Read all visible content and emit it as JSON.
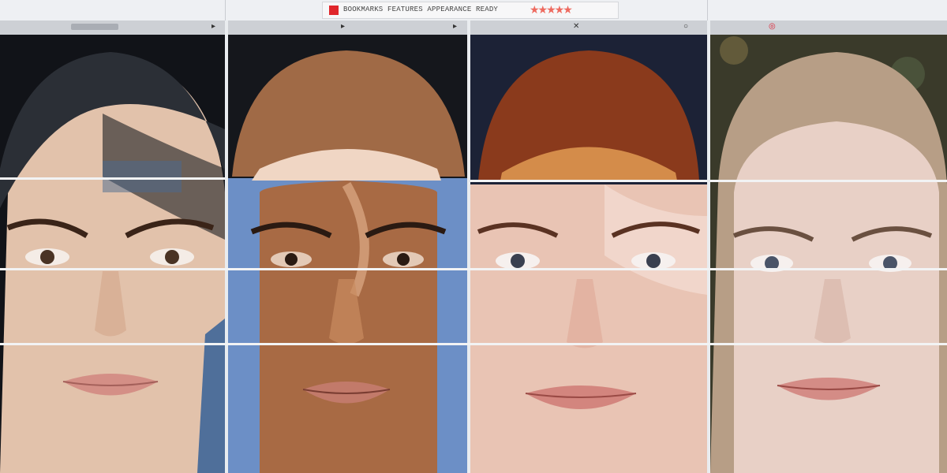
{
  "window": {
    "title_text": "BOOKMARKS  FEATURES  APPEARANCE  READY",
    "stars_text": "★★★★★",
    "toolbar_glyphs": [
      "▸",
      "▸",
      "▸",
      "✕",
      "○",
      "◎"
    ]
  },
  "panels": [
    {
      "name": "face-1",
      "hair": "#2b2f36",
      "skin": "#e4c4ae",
      "bg": "#111318"
    },
    {
      "name": "face-2",
      "hair": "#a06a46",
      "skin": "#a86a44",
      "bg": "#15171c",
      "scarf": "#6c8fc6"
    },
    {
      "name": "face-3",
      "hair": "#8a3a1c",
      "skin": "#e9c4b4",
      "bg": "#1c2236"
    },
    {
      "name": "face-4",
      "hair": "#b79e86",
      "skin": "#e8d0c6",
      "bg": "#3a3a2a"
    }
  ],
  "colors": {
    "divider": "#e9ecef",
    "accent": "#e0262b"
  }
}
